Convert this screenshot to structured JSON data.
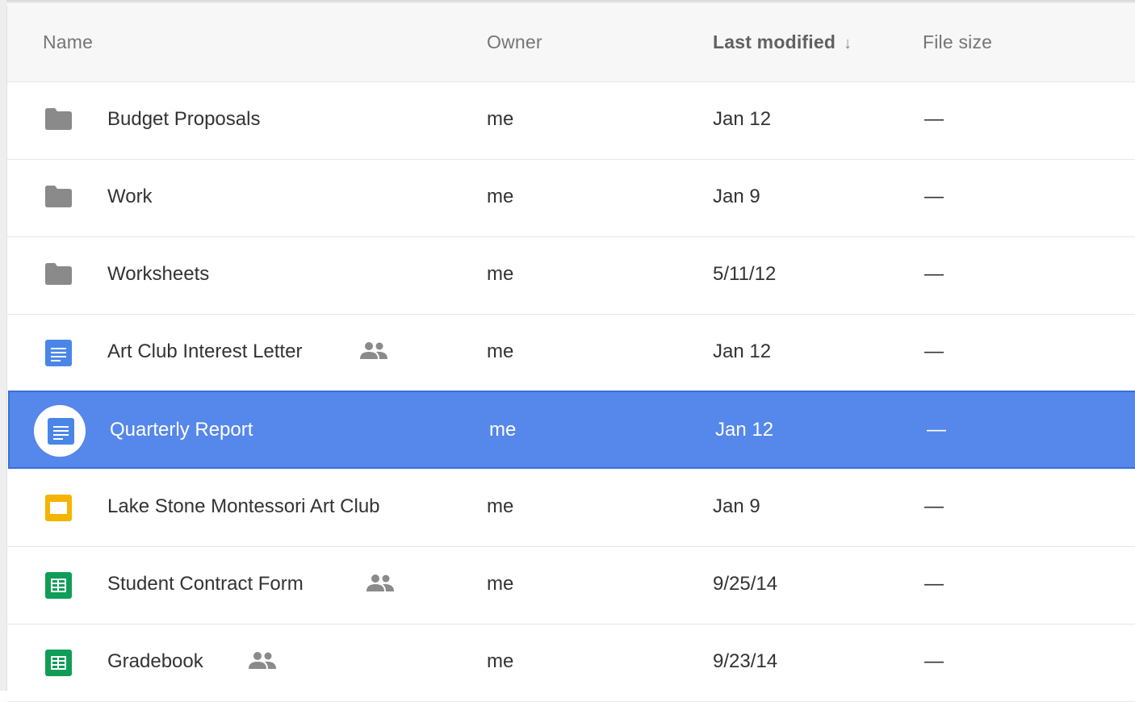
{
  "columns": {
    "name": "Name",
    "owner": "Owner",
    "last_modified": "Last modified",
    "sort_arrow": "↓",
    "file_size": "File size"
  },
  "colors": {
    "selected_row": "#5687ea",
    "folder_icon": "#8a8a8a",
    "doc_icon": "#4a86e8",
    "slides_icon": "#f4b400",
    "sheets_icon": "#0f9d58"
  },
  "files": [
    {
      "name": "Budget Proposals",
      "owner": "me",
      "modified": "Jan 12",
      "size": "—",
      "icon": "folder-icon",
      "shared": false,
      "selected": false
    },
    {
      "name": "Work",
      "owner": "me",
      "modified": "Jan 9",
      "size": "—",
      "icon": "folder-icon",
      "shared": false,
      "selected": false
    },
    {
      "name": "Worksheets",
      "owner": "me",
      "modified": "5/11/12",
      "size": "—",
      "icon": "folder-icon",
      "shared": false,
      "selected": false
    },
    {
      "name": "Art Club Interest Letter",
      "owner": "me",
      "modified": "Jan 12",
      "size": "—",
      "icon": "doc-icon",
      "shared": true,
      "selected": false
    },
    {
      "name": "Quarterly Report",
      "owner": "me",
      "modified": "Jan 12",
      "size": "—",
      "icon": "doc-icon",
      "shared": false,
      "selected": true
    },
    {
      "name": "Lake Stone Montessori Art Club",
      "owner": "me",
      "modified": "Jan 9",
      "size": "—",
      "icon": "slides-icon",
      "shared": false,
      "selected": false
    },
    {
      "name": "Student Contract Form",
      "owner": "me",
      "modified": "9/25/14",
      "size": "—",
      "icon": "sheets-icon",
      "shared": true,
      "selected": false
    },
    {
      "name": "Gradebook",
      "owner": "me",
      "modified": "9/23/14",
      "size": "—",
      "icon": "sheets-icon",
      "shared": true,
      "selected": false
    }
  ]
}
